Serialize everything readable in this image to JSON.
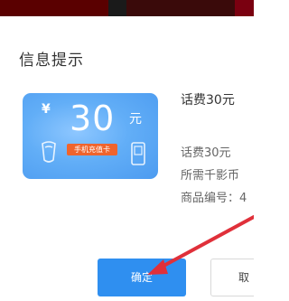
{
  "dialog": {
    "title": "信息提示"
  },
  "card": {
    "currency_symbol": "¥",
    "amount": "30",
    "unit": "元",
    "tag": "手机充值卡"
  },
  "product": {
    "title": "话费30元",
    "line1": "话费30元",
    "line2": "所需千影币",
    "line3": "商品编号：4"
  },
  "buttons": {
    "confirm": "确定",
    "cancel": "取"
  },
  "colors": {
    "primary": "#2f8ff0",
    "card_blue": "#5aa8f5",
    "tag_orange": "#f0642d",
    "arrow_red": "#e0303a"
  },
  "icons": {
    "arrow": "red-arrow",
    "phone": "phone-icon"
  }
}
